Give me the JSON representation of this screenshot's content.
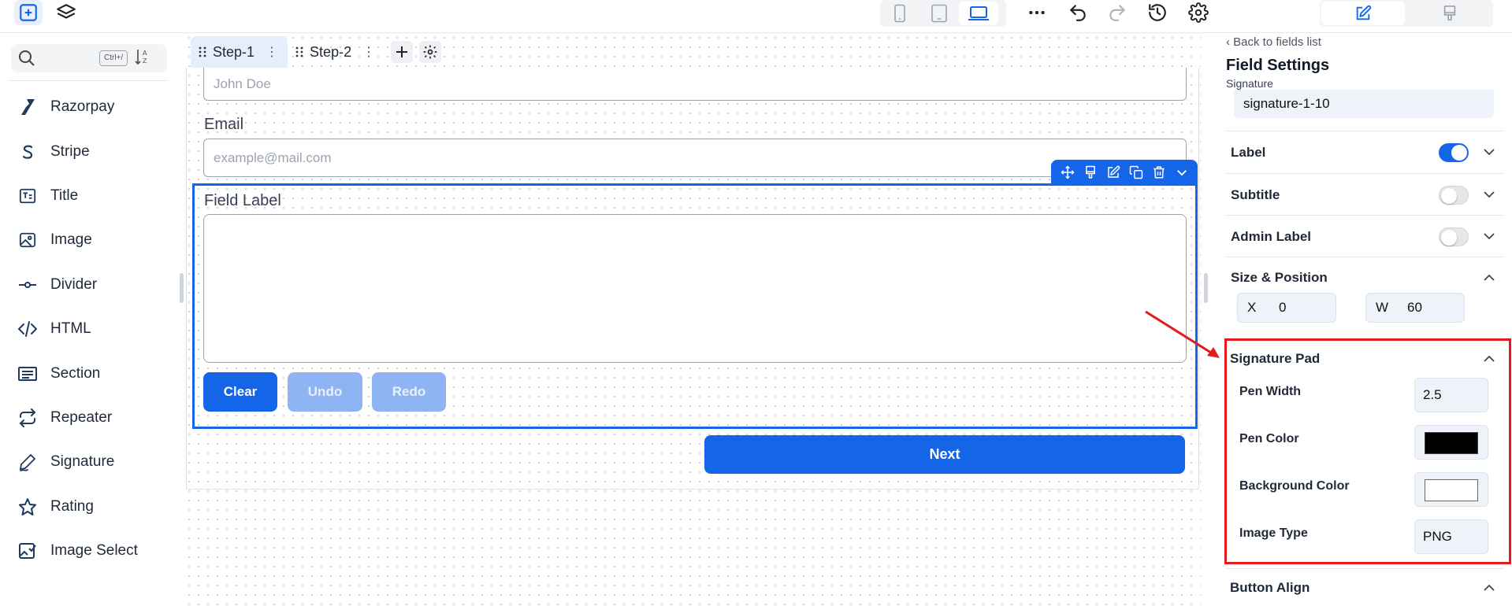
{
  "topbar": {
    "add_icon": "plus-square-icon",
    "layers_icon": "layers-icon",
    "devices": [
      "mobile-icon",
      "tablet-icon",
      "laptop-icon"
    ],
    "more_icon": "more-horizontal-icon",
    "undo_icon": "undo-icon",
    "redo_icon": "redo-icon",
    "history_icon": "history-icon",
    "settings_icon": "gear-icon",
    "modes": [
      "edit-icon",
      "style-brush-icon"
    ]
  },
  "sidebar": {
    "search": {
      "placeholder": "",
      "shortcut": "Ctrl+/"
    },
    "items": [
      {
        "label": "Razorpay",
        "icon": "razorpay-icon"
      },
      {
        "label": "Stripe",
        "icon": "stripe-icon"
      },
      {
        "label": "Title",
        "icon": "title-icon"
      },
      {
        "label": "Image",
        "icon": "image-icon"
      },
      {
        "label": "Divider",
        "icon": "divider-icon"
      },
      {
        "label": "HTML",
        "icon": "code-icon"
      },
      {
        "label": "Section",
        "icon": "section-icon"
      },
      {
        "label": "Repeater",
        "icon": "repeat-icon"
      },
      {
        "label": "Signature",
        "icon": "signature-icon"
      },
      {
        "label": "Rating",
        "icon": "star-icon"
      },
      {
        "label": "Image Select",
        "icon": "image-select-icon"
      }
    ]
  },
  "canvas": {
    "tabs": [
      {
        "label": "Step-1",
        "active": true
      },
      {
        "label": "Step-2",
        "active": false
      }
    ],
    "name_field": {
      "placeholder": "John Doe"
    },
    "email_field": {
      "label": "Email",
      "placeholder": "example@mail.com"
    },
    "signature_field": {
      "label": "Field Label"
    },
    "buttons": {
      "clear": "Clear",
      "undo": "Undo",
      "redo": "Redo",
      "next": "Next"
    }
  },
  "right_panel": {
    "back_link": "Back to fields list",
    "title": "Field Settings",
    "subtitle": "Signature",
    "field_id": "signature-1-10",
    "rows": {
      "label": {
        "text": "Label",
        "toggle": true
      },
      "subtitle": {
        "text": "Subtitle",
        "toggle": false
      },
      "admin_label": {
        "text": "Admin Label",
        "toggle": false
      },
      "size_position": {
        "text": "Size & Position",
        "x_label": "X",
        "x_value": "0",
        "w_label": "W",
        "w_value": "60"
      }
    },
    "signature_pad": {
      "title": "Signature Pad",
      "pen_width_label": "Pen Width",
      "pen_width": "2.5",
      "pen_color_label": "Pen Color",
      "pen_color": "#000000",
      "bg_color_label": "Background Color",
      "bg_color": "#ffffff",
      "image_type_label": "Image Type",
      "image_type": "PNG"
    },
    "button_align": "Button Align"
  },
  "colors": {
    "accent": "#1565e8",
    "highlight": "#e41a1c"
  }
}
